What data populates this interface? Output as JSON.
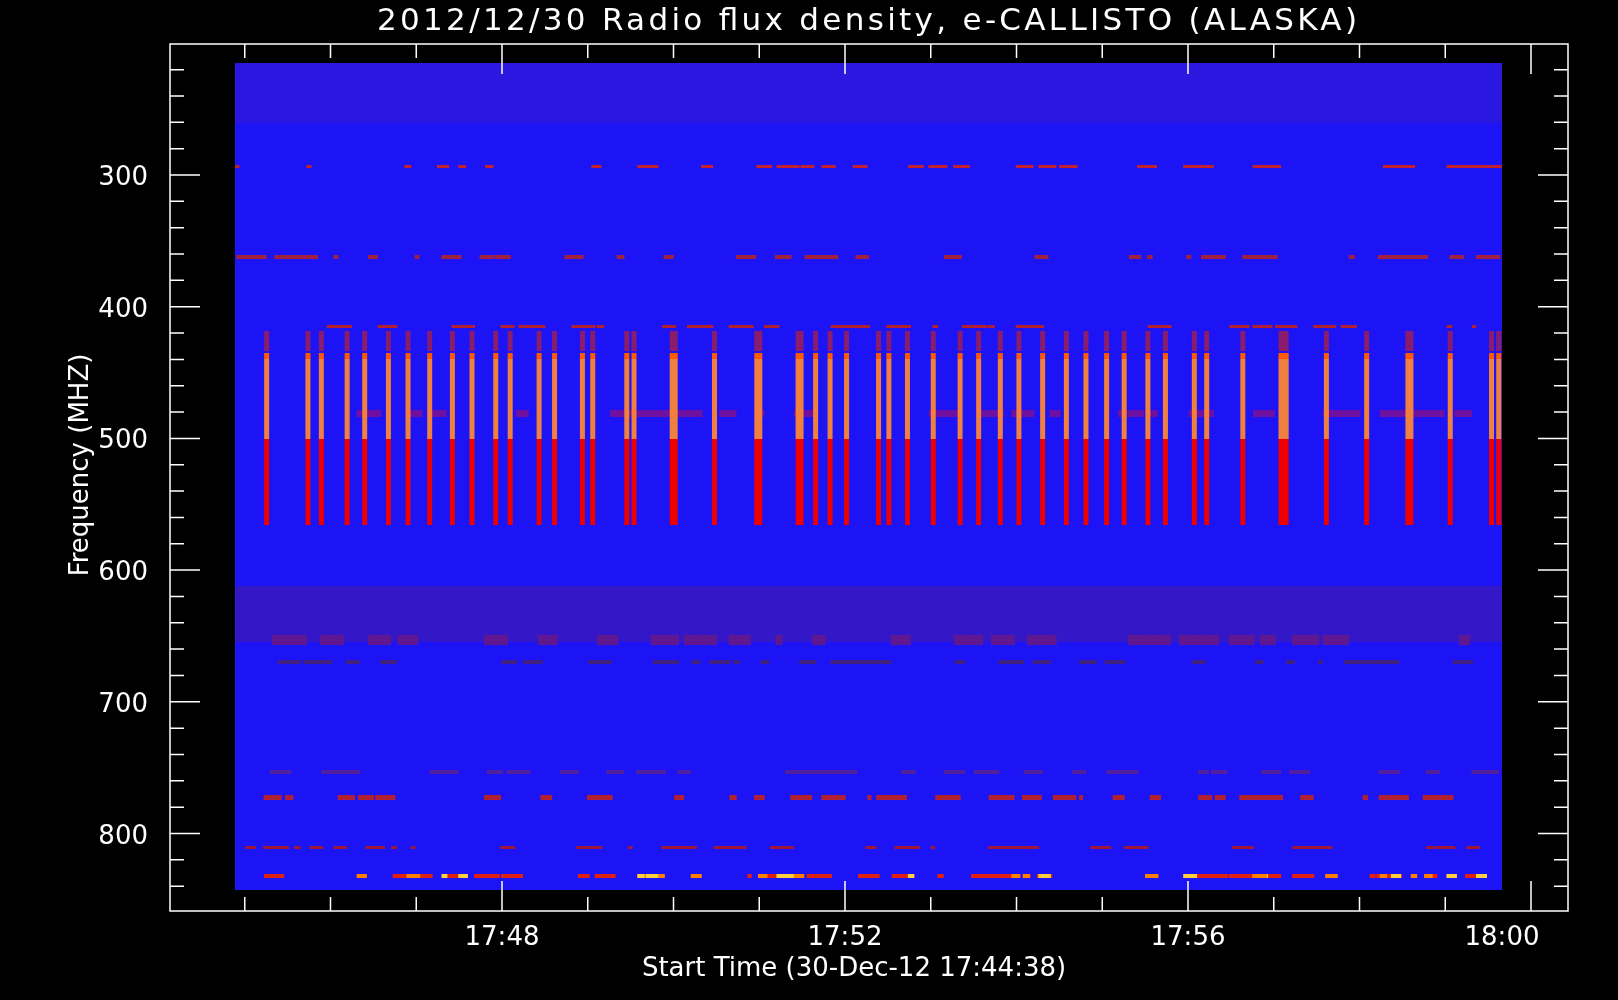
{
  "title": "2012/12/30  Radio flux density, e-CALLISTO (ALASKA)",
  "plot": {
    "y_axis": {
      "label": "Frequency (MHZ)",
      "tick_labels": [
        "300",
        "400",
        "500",
        "600",
        "700",
        "800"
      ]
    },
    "x_axis": {
      "label": "Start Time (30-Dec-12 17:44:38)",
      "tick_labels": [
        "17:48",
        "17:52",
        "17:56",
        "18:00"
      ]
    }
  }
}
